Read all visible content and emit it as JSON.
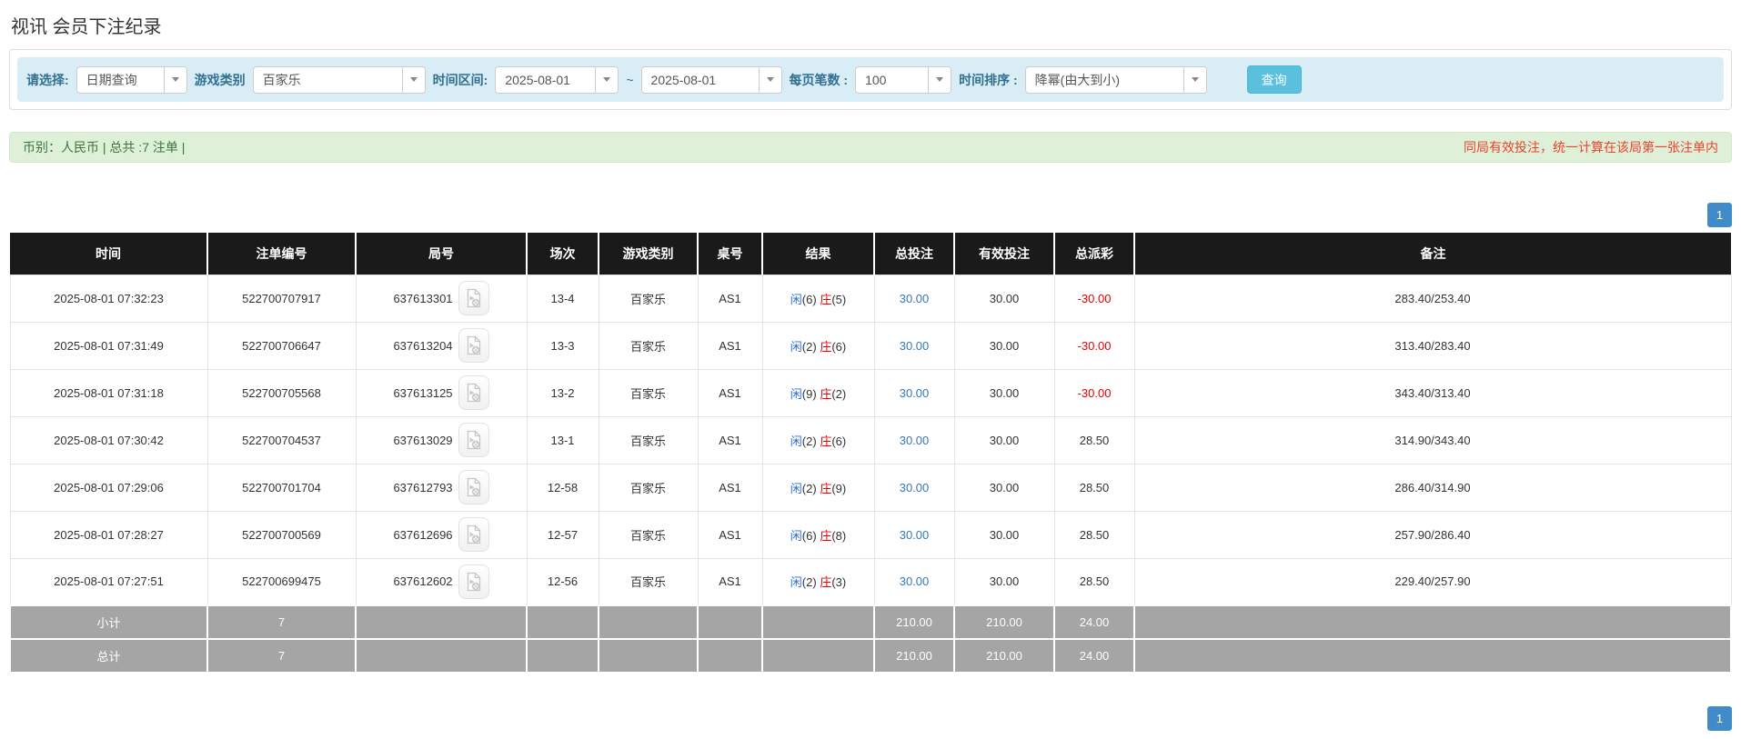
{
  "page": {
    "title": "视讯 会员下注纪录"
  },
  "filters": {
    "select_label": "请选择:",
    "select_value": "日期查询",
    "game_type_label": "游戏类别",
    "game_type_value": "百家乐",
    "time_range_label": "时间区间:",
    "date_from": "2025-08-01",
    "range_separator": "~",
    "date_to": "2025-08-01",
    "page_size_label": "每页笔数 :",
    "page_size_value": "100",
    "sort_label": "时间排序 :",
    "sort_value": "降幂(由大到小)",
    "search_button": "查询"
  },
  "summary": {
    "left_text": "币别：人民币 | 总共 :7 注单 |",
    "right_note": "同局有效投注，统一计算在该局第一张注单内"
  },
  "pagination": {
    "page": "1"
  },
  "icons": {
    "caret": "caret-down-icon",
    "video": "video-replay-icon"
  },
  "colors": {
    "accent_blue": "#428bca",
    "button_info": "#5bc0de",
    "link_blue": "#337ab7",
    "player_blue": "#2b6cd4",
    "banker_red": "#e60000",
    "negative_red": "#e60000",
    "header_bg": "#1a1a1a",
    "footer_bg": "#a5a5a5",
    "filter_bg": "#d9edf7",
    "summary_bg": "#dff0d8"
  },
  "table": {
    "headers": [
      "时间",
      "注单编号",
      "局号",
      "场次",
      "游戏类别",
      "桌号",
      "结果",
      "总投注",
      "有效投注",
      "总派彩",
      "备注"
    ],
    "rows": [
      {
        "time": "2025-08-01 07:32:23",
        "bet_id": "522700707917",
        "round_id": "637613301",
        "session": "13-4",
        "game": "百家乐",
        "table_no": "AS1",
        "result": {
          "player_label": "闲",
          "player_value": "(6)",
          "banker_label": "庄",
          "banker_value": "(5)"
        },
        "total_bet": "30.00",
        "valid_bet": "30.00",
        "payout": "-30.00",
        "payout_negative": true,
        "remark": "283.40/253.40"
      },
      {
        "time": "2025-08-01 07:31:49",
        "bet_id": "522700706647",
        "round_id": "637613204",
        "session": "13-3",
        "game": "百家乐",
        "table_no": "AS1",
        "result": {
          "player_label": "闲",
          "player_value": "(2)",
          "banker_label": "庄",
          "banker_value": "(6)"
        },
        "total_bet": "30.00",
        "valid_bet": "30.00",
        "payout": "-30.00",
        "payout_negative": true,
        "remark": "313.40/283.40"
      },
      {
        "time": "2025-08-01 07:31:18",
        "bet_id": "522700705568",
        "round_id": "637613125",
        "session": "13-2",
        "game": "百家乐",
        "table_no": "AS1",
        "result": {
          "player_label": "闲",
          "player_value": "(9)",
          "banker_label": "庄",
          "banker_value": "(2)"
        },
        "total_bet": "30.00",
        "valid_bet": "30.00",
        "payout": "-30.00",
        "payout_negative": true,
        "remark": "343.40/313.40"
      },
      {
        "time": "2025-08-01 07:30:42",
        "bet_id": "522700704537",
        "round_id": "637613029",
        "session": "13-1",
        "game": "百家乐",
        "table_no": "AS1",
        "result": {
          "player_label": "闲",
          "player_value": "(2)",
          "banker_label": "庄",
          "banker_value": "(6)"
        },
        "total_bet": "30.00",
        "valid_bet": "30.00",
        "payout": "28.50",
        "payout_negative": false,
        "remark": "314.90/343.40"
      },
      {
        "time": "2025-08-01 07:29:06",
        "bet_id": "522700701704",
        "round_id": "637612793",
        "session": "12-58",
        "game": "百家乐",
        "table_no": "AS1",
        "result": {
          "player_label": "闲",
          "player_value": "(2)",
          "banker_label": "庄",
          "banker_value": "(9)"
        },
        "total_bet": "30.00",
        "valid_bet": "30.00",
        "payout": "28.50",
        "payout_negative": false,
        "remark": "286.40/314.90"
      },
      {
        "time": "2025-08-01 07:28:27",
        "bet_id": "522700700569",
        "round_id": "637612696",
        "session": "12-57",
        "game": "百家乐",
        "table_no": "AS1",
        "result": {
          "player_label": "闲",
          "player_value": "(6)",
          "banker_label": "庄",
          "banker_value": "(8)"
        },
        "total_bet": "30.00",
        "valid_bet": "30.00",
        "payout": "28.50",
        "payout_negative": false,
        "remark": "257.90/286.40"
      },
      {
        "time": "2025-08-01 07:27:51",
        "bet_id": "522700699475",
        "round_id": "637612602",
        "session": "12-56",
        "game": "百家乐",
        "table_no": "AS1",
        "result": {
          "player_label": "闲",
          "player_value": "(2)",
          "banker_label": "庄",
          "banker_value": "(3)"
        },
        "total_bet": "30.00",
        "valid_bet": "30.00",
        "payout": "28.50",
        "payout_negative": false,
        "remark": "229.40/257.90"
      }
    ],
    "footer_rows": [
      {
        "label": "小计",
        "count": "7",
        "total_bet": "210.00",
        "valid_bet": "210.00",
        "payout": "24.00"
      },
      {
        "label": "总计",
        "count": "7",
        "total_bet": "210.00",
        "valid_bet": "210.00",
        "payout": "24.00"
      }
    ]
  }
}
